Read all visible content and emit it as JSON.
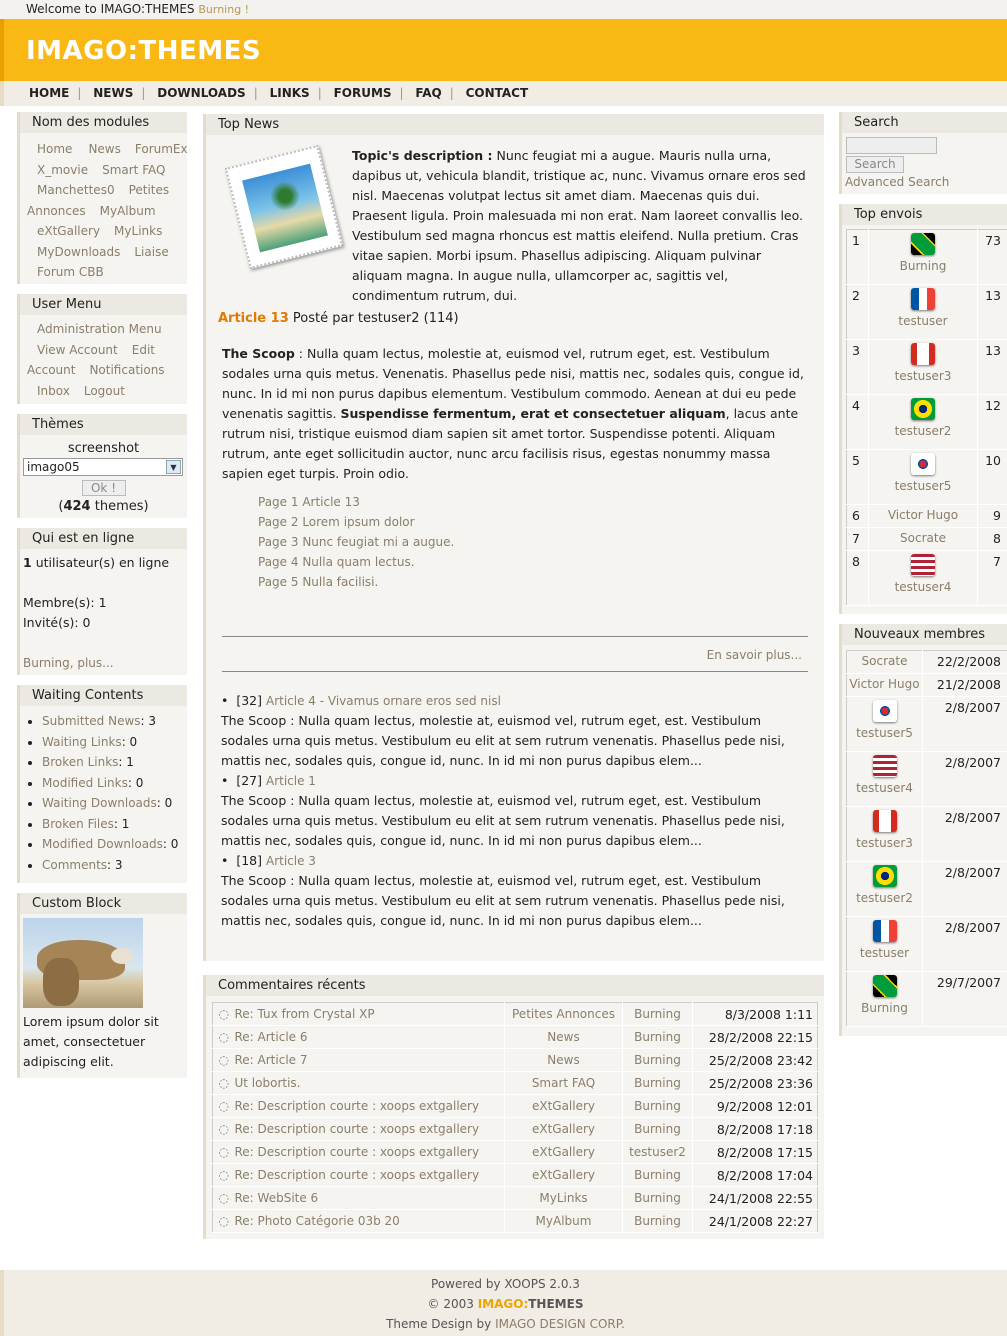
{
  "topbar": {
    "welcome": "Welcome to IMAGO:THEMES",
    "user": "Burning !"
  },
  "header": {
    "logo": "IMAGO:THEMES"
  },
  "nav": [
    "HOME",
    "NEWS",
    "DOWNLOADS",
    "LINKS",
    "FORUMS",
    "FAQ",
    "CONTACT"
  ],
  "modules": {
    "title": "Nom des modules",
    "items": [
      "Home",
      "News",
      "ForumEx",
      "X_movie",
      "Smart FAQ",
      "Manchettes0",
      "Petites",
      "Annonces",
      "MyAlbum",
      "eXtGallery",
      "MyLinks",
      "MyDownloads",
      "Liaise",
      "Forum CBB"
    ]
  },
  "usermenu": {
    "title": "User Menu",
    "items": [
      "Administration Menu",
      "View Account",
      "Edit",
      "Account",
      "Notifications",
      "Inbox",
      "Logout"
    ]
  },
  "themes": {
    "title": "Thèmes",
    "screenshot": "screenshot",
    "selected": "imago05",
    "ok": "Ok !",
    "count": "424",
    "suffix": "themes)",
    "prefix": "("
  },
  "online": {
    "title": "Qui est en ligne",
    "count": "1",
    "count_text": "utilisateur(s) en ligne",
    "members": "Membre(s): 1",
    "guests": "Invité(s): 0",
    "last": "Burning, plus..."
  },
  "waiting": {
    "title": "Waiting Contents",
    "items": [
      {
        "label": "Submitted News",
        "value": ": 3"
      },
      {
        "label": "Waiting Links",
        "value": ": 0"
      },
      {
        "label": "Broken Links",
        "value": ": 1"
      },
      {
        "label": "Modified Links",
        "value": ": 0"
      },
      {
        "label": "Waiting Downloads",
        "value": ": 0"
      },
      {
        "label": "Broken Files",
        "value": ": 1"
      },
      {
        "label": "Modified Downloads",
        "value": ": 0"
      },
      {
        "label": "Comments",
        "value": ": 3"
      }
    ]
  },
  "custom": {
    "title": "Custom Block",
    "text": "Lorem ipsum dolor sit amet, consectetuer adipiscing elit."
  },
  "topnews": {
    "title": "Top News",
    "desc_label": "Topic's description :",
    "desc": "Nunc feugiat mi a augue. Mauris nulla urna, dapibus ut, vehicula blandit, tristique ac, nunc. Vivamus ornare eros sed nisl. Maecenas volutpat lectus sit amet diam. Maecenas quis dui. Praesent ligula. Proin malesuada mi non erat. Nam laoreet convallis leo. Vestibulum sed magna rhoncus est mattis eleifend. Nulla pretium. Cras vitae sapien. Morbi ipsum. Phasellus adipiscing. Aliquam pulvinar aliquam magna. In augue nulla, ullamcorper ac, sagittis vel, condimentum rutrum, dui.",
    "article": "Article 13",
    "posted": "Posté par testuser2 (114)",
    "scoop_label": "The Scoop",
    "scoop1": ": Nulla quam lectus, molestie at, euismod vel, rutrum eget, est. Vestibulum sodales urna quis metus. Venenatis. Phasellus pede nisi, mattis nec, sodales quis, congue id, nunc. In id mi non purus dapibus elementum. Vestibulum commodo. Aenean at dui eu pede venenatis sagittis.",
    "scoop_bold": "Suspendisse fermentum, erat et consectetuer aliquam",
    "scoop2": ", lacus ante rutrum nisi, tristique euismod diam sapien sit amet tortor. Suspendisse potenti. Aliquam rutrum, ante eget sollicitudin auctor, nunc arcu facilisis risus, egestas nonummy massa sapien eget turpis. Proin odio.",
    "pages": [
      "Page 1 Article 13",
      "Page 2 Lorem ipsum dolor",
      "Page 3 Nunc feugiat mi a augue.",
      "Page 4 Nulla quam lectus.",
      "Page 5 Nulla facilisi."
    ],
    "more": "En savoir plus...",
    "list": [
      {
        "num": "[32]",
        "title": "Article 4 - Vivamus ornare eros sed nisl",
        "text": "The Scoop : Nulla quam lectus, molestie at, euismod vel, rutrum eget, est. Vestibulum sodales urna quis metus. Vestibulum eu elit at sem rutrum venenatis. Phasellus pede nisi, mattis nec, sodales quis, congue id, nunc. In id mi non purus dapibus elem..."
      },
      {
        "num": "[27]",
        "title": "Article 1",
        "text": "The Scoop : Nulla quam lectus, molestie at, euismod vel, rutrum eget, est. Vestibulum sodales urna quis metus. Vestibulum eu elit at sem rutrum venenatis. Phasellus pede nisi, mattis nec, sodales quis, congue id, nunc. In id mi non purus dapibus elem..."
      },
      {
        "num": "[18]",
        "title": "Article 3",
        "text": "The Scoop : Nulla quam lectus, molestie at, euismod vel, rutrum eget, est. Vestibulum sodales urna quis metus. Vestibulum eu elit at sem rutrum venenatis. Phasellus pede nisi, mattis nec, sodales quis, congue id, nunc. In id mi non purus dapibus elem..."
      }
    ]
  },
  "comments": {
    "title": "Commentaires récents",
    "rows": [
      {
        "t": "Re: Tux from Crystal XP",
        "m": "Petites Annonces",
        "u": "Burning",
        "d": "8/3/2008 1:11"
      },
      {
        "t": "Re: Article 6",
        "m": "News",
        "u": "Burning",
        "d": "28/2/2008 22:15"
      },
      {
        "t": "Re: Article 7",
        "m": "News",
        "u": "Burning",
        "d": "25/2/2008 23:42"
      },
      {
        "t": "Ut lobortis.",
        "m": "Smart FAQ",
        "u": "Burning",
        "d": "25/2/2008 23:36"
      },
      {
        "t": "Re: Description courte : xoops extgallery",
        "m": "eXtGallery",
        "u": "Burning",
        "d": "9/2/2008 12:01"
      },
      {
        "t": "Re: Description courte : xoops extgallery",
        "m": "eXtGallery",
        "u": "Burning",
        "d": "8/2/2008 17:18"
      },
      {
        "t": "Re: Description courte : xoops extgallery",
        "m": "eXtGallery",
        "u": "testuser2",
        "d": "8/2/2008 17:15"
      },
      {
        "t": "Re: Description courte : xoops extgallery",
        "m": "eXtGallery",
        "u": "Burning",
        "d": "8/2/2008 17:04"
      },
      {
        "t": "Re: WebSite 6",
        "m": "MyLinks",
        "u": "Burning",
        "d": "24/1/2008 22:55"
      },
      {
        "t": "Re: Photo Catégorie 03b 20",
        "m": "MyAlbum",
        "u": "Burning",
        "d": "24/1/2008 22:27"
      }
    ]
  },
  "search": {
    "title": "Search",
    "button": "Search",
    "advanced": "Advanced Search"
  },
  "topenvois": {
    "title": "Top envois",
    "rows": [
      {
        "rank": "1",
        "flag": "jamaica-flag-icon",
        "name": "Burning",
        "count": "73"
      },
      {
        "rank": "2",
        "flag": "france-flag-icon",
        "name": "testuser",
        "count": "13"
      },
      {
        "rank": "3",
        "flag": "canada-flag-icon",
        "name": "testuser3",
        "count": "13"
      },
      {
        "rank": "4",
        "flag": "brazil-flag-icon",
        "name": "testuser2",
        "count": "12"
      },
      {
        "rank": "5",
        "flag": "korea-flag-icon",
        "name": "testuser5",
        "count": "10"
      },
      {
        "rank": "6",
        "flag": "",
        "name": "Victor Hugo",
        "count": "9"
      },
      {
        "rank": "7",
        "flag": "",
        "name": "Socrate",
        "count": "8"
      },
      {
        "rank": "8",
        "flag": "usa-flag-icon",
        "name": "testuser4",
        "count": "7"
      }
    ]
  },
  "newmembers": {
    "title": "Nouveaux membres",
    "rows": [
      {
        "flag": "",
        "name": "Socrate",
        "date": "22/2/2008"
      },
      {
        "flag": "",
        "name": "Victor Hugo",
        "date": "21/2/2008"
      },
      {
        "flag": "korea-flag-icon",
        "name": "testuser5",
        "date": "2/8/2007"
      },
      {
        "flag": "usa-flag-icon",
        "name": "testuser4",
        "date": "2/8/2007"
      },
      {
        "flag": "canada-flag-icon",
        "name": "testuser3",
        "date": "2/8/2007"
      },
      {
        "flag": "brazil-flag-icon",
        "name": "testuser2",
        "date": "2/8/2007"
      },
      {
        "flag": "france-flag-icon",
        "name": "testuser",
        "date": "2/8/2007"
      },
      {
        "flag": "jamaica-flag-icon",
        "name": "Burning",
        "date": "29/7/2007"
      }
    ]
  },
  "footer": {
    "powered": "Powered by XOOPS 2.0.3",
    "copy": "© 2003",
    "brand1": "IMAGO:",
    "brand2": "THEMES",
    "design": "Theme Design by",
    "corp": "IMAGO DESIGN CORP."
  }
}
